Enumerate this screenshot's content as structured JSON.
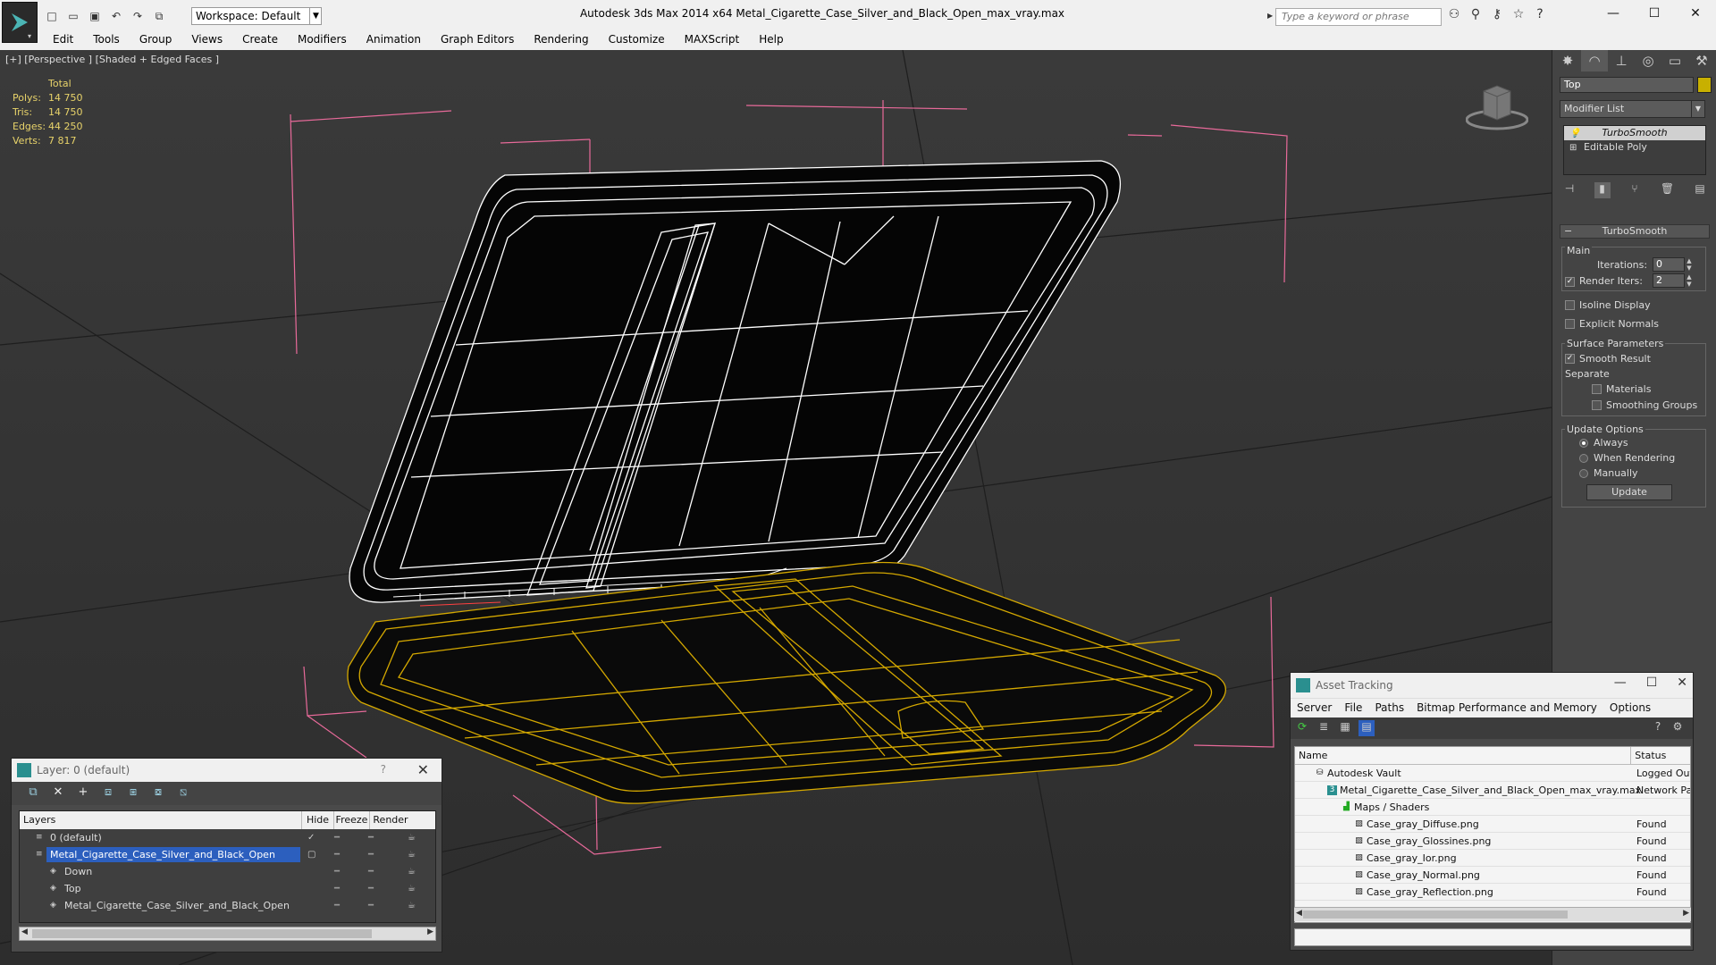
{
  "titlebar": {
    "workspace": "Workspace: Default",
    "title": "Autodesk 3ds Max  2014 x64      Metal_Cigarette_Case_Silver_and_Black_Open_max_vray.max",
    "search_placeholder": "Type a keyword or phrase",
    "minimize": "—",
    "maximize": "☐",
    "close": "✕"
  },
  "menu": [
    "Edit",
    "Tools",
    "Group",
    "Views",
    "Create",
    "Modifiers",
    "Animation",
    "Graph Editors",
    "Rendering",
    "Customize",
    "MAXScript",
    "Help"
  ],
  "viewport": {
    "label": "[+] [Perspective ] [Shaded + Edged Faces ]",
    "stats_header": "Total",
    "stats": [
      {
        "label": "Polys:",
        "value": "14 750"
      },
      {
        "label": "Tris:",
        "value": "14 750"
      },
      {
        "label": "Edges:",
        "value": "44 250"
      },
      {
        "label": "Verts:",
        "value": "7 817"
      }
    ]
  },
  "command_panel": {
    "object_name": "Top",
    "object_color": "#c8b000",
    "modifier_list": "Modifier List",
    "stack": [
      "TurboSmooth",
      "Editable Poly"
    ],
    "rollout_title": "TurboSmooth",
    "main_label": "Main",
    "iterations_label": "Iterations:",
    "iterations_value": "0",
    "render_iters_label": "Render Iters:",
    "render_iters_value": "2",
    "isoline_label": "Isoline Display",
    "explicit_label": "Explicit Normals",
    "surface_label": "Surface Parameters",
    "smooth_result_label": "Smooth Result",
    "separate_label": "Separate",
    "materials_label": "Materials",
    "smoothing_groups_label": "Smoothing Groups",
    "update_options_label": "Update Options",
    "always_label": "Always",
    "when_rendering_label": "When Rendering",
    "manually_label": "Manually",
    "update_button": "Update"
  },
  "layer_panel": {
    "title": "Layer: 0 (default)",
    "help": "?",
    "close": "✕",
    "columns": [
      "Layers",
      "Hide",
      "Freeze",
      "Render"
    ],
    "rows": [
      {
        "name": "0 (default)",
        "indent": 0,
        "selected": false
      },
      {
        "name": "Metal_Cigarette_Case_Silver_and_Black_Open",
        "indent": 0,
        "selected": true
      },
      {
        "name": "Down",
        "indent": 1,
        "selected": false
      },
      {
        "name": "Top",
        "indent": 1,
        "selected": false
      },
      {
        "name": "Metal_Cigarette_Case_Silver_and_Black_Open",
        "indent": 1,
        "selected": false
      }
    ]
  },
  "asset_panel": {
    "title": "Asset Tracking",
    "menu": [
      "Server",
      "File",
      "Paths",
      "Bitmap Performance and Memory",
      "Options"
    ],
    "columns": [
      "Name",
      "Status"
    ],
    "rows": [
      {
        "name": "Autodesk Vault",
        "status": "Logged Out",
        "level": 0
      },
      {
        "name": "Metal_Cigarette_Case_Silver_and_Black_Open_max_vray.max",
        "status": "Network Pa",
        "level": 1
      },
      {
        "name": "Maps / Shaders",
        "status": "",
        "level": 2
      },
      {
        "name": "Case_gray_Diffuse.png",
        "status": "Found",
        "level": 3
      },
      {
        "name": "Case_gray_Glossines.png",
        "status": "Found",
        "level": 3
      },
      {
        "name": "Case_gray_Ior.png",
        "status": "Found",
        "level": 3
      },
      {
        "name": "Case_gray_Normal.png",
        "status": "Found",
        "level": 3
      },
      {
        "name": "Case_gray_Reflection.png",
        "status": "Found",
        "level": 3
      }
    ]
  }
}
